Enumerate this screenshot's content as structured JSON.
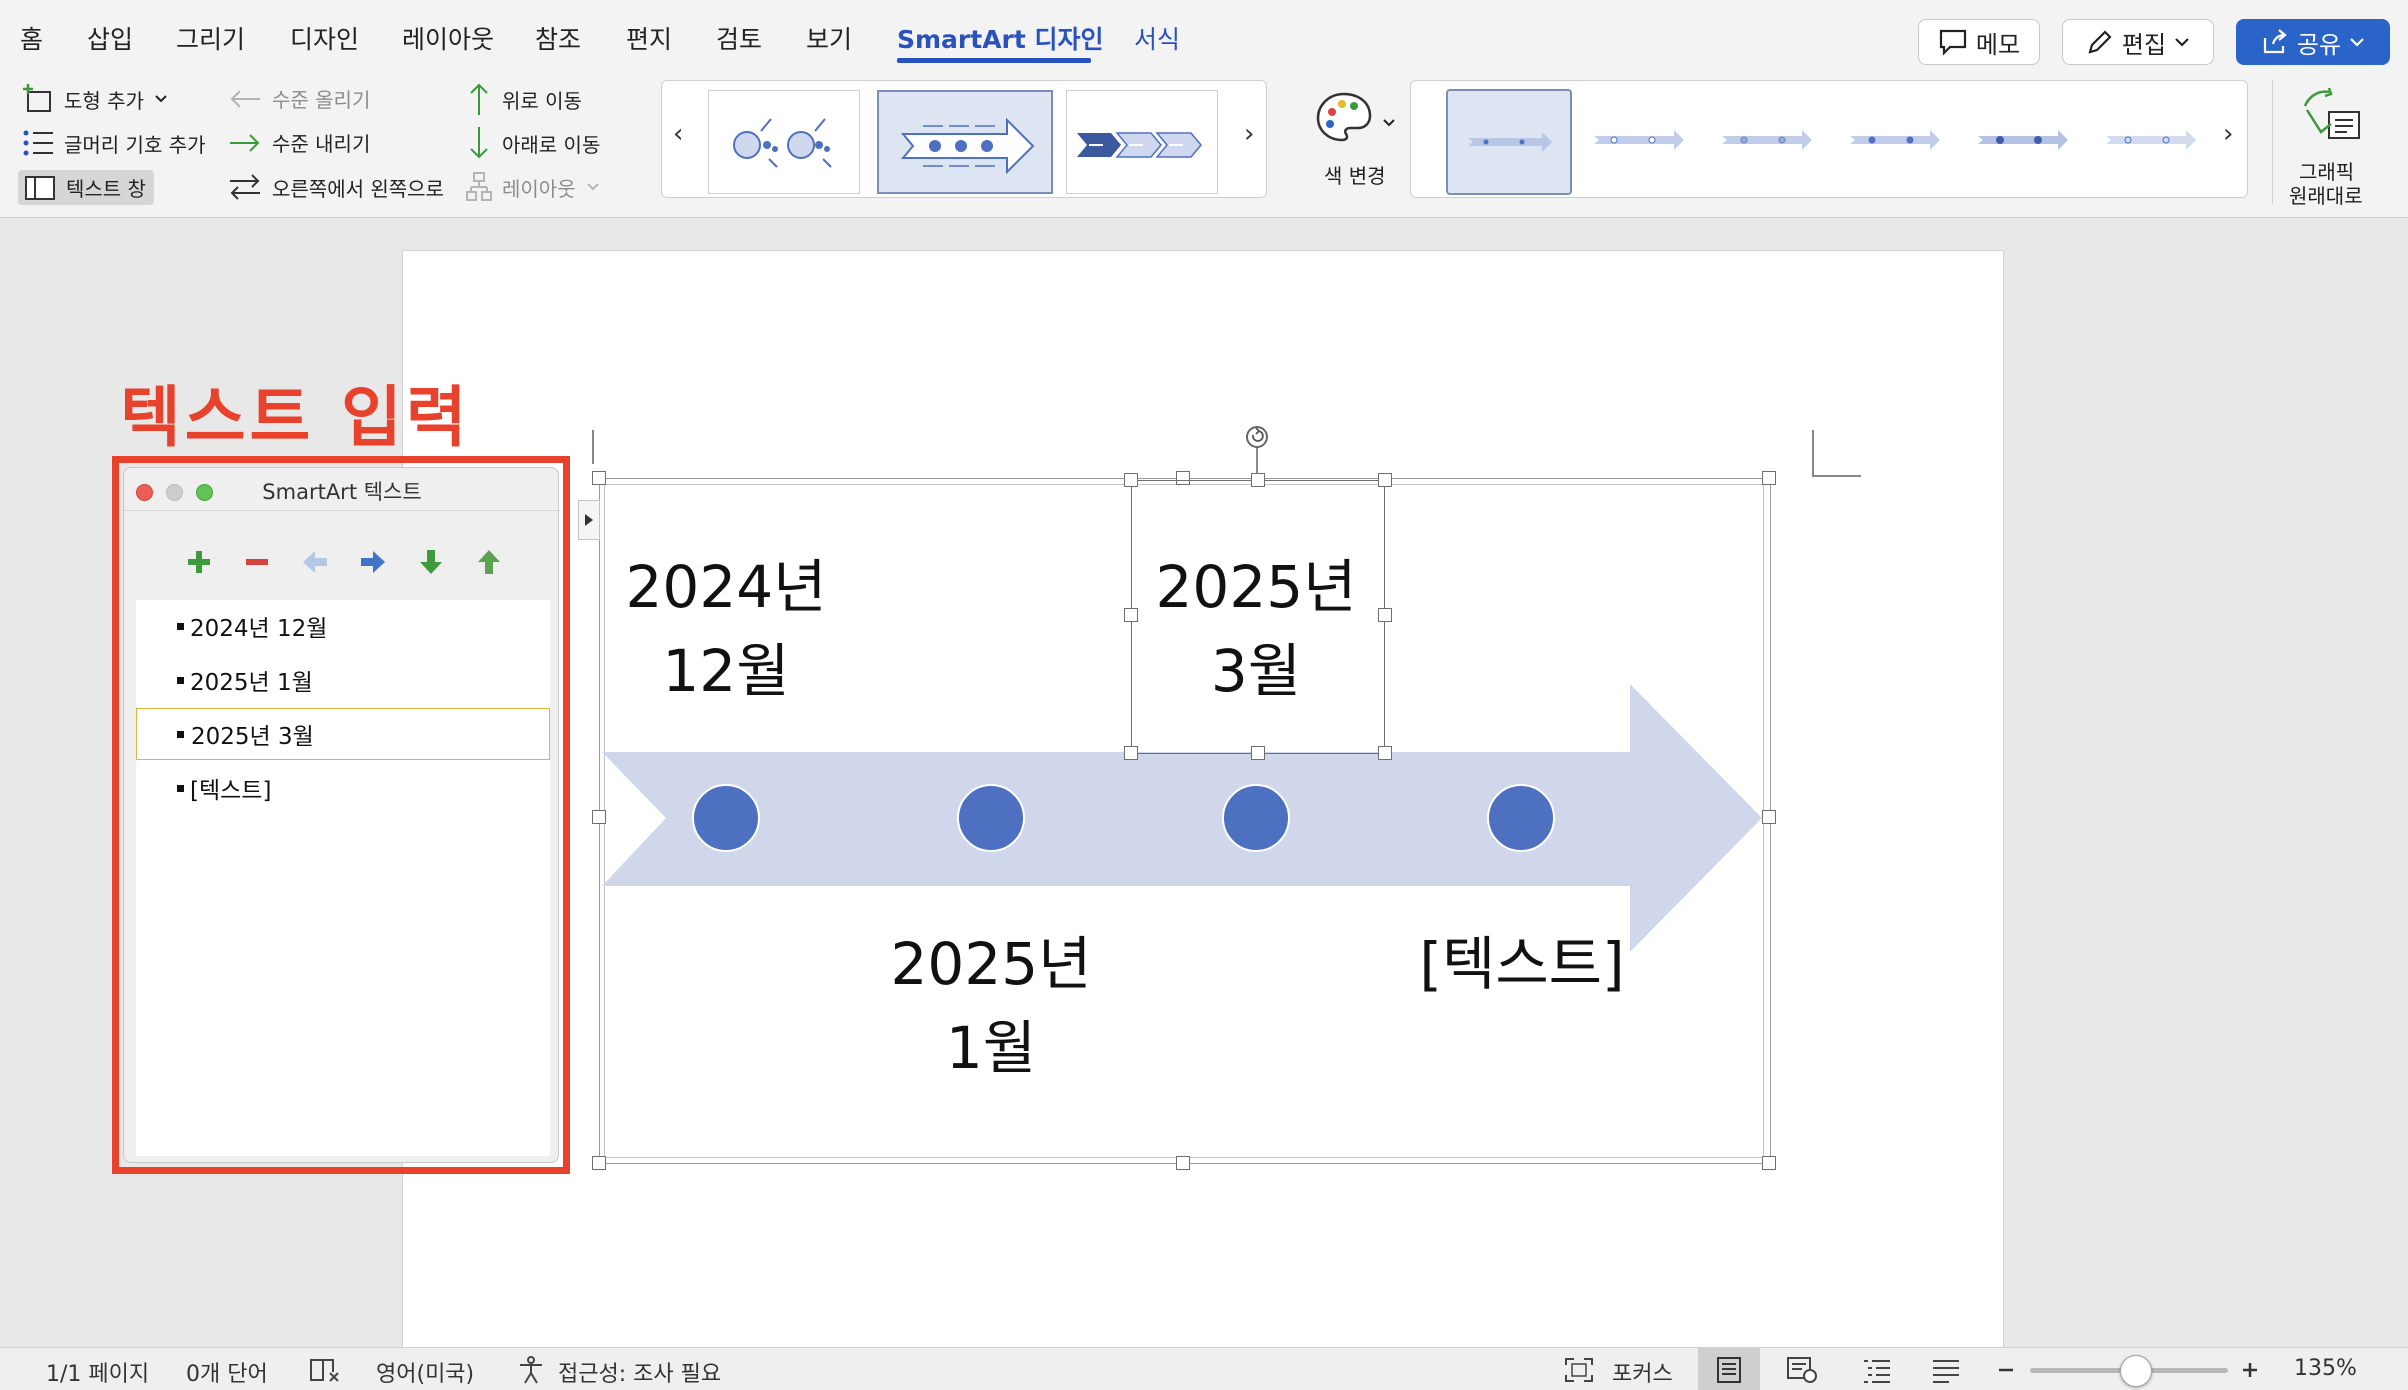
{
  "tabs": [
    {
      "label": "홈"
    },
    {
      "label": "삽입"
    },
    {
      "label": "그리기"
    },
    {
      "label": "디자인"
    },
    {
      "label": "레이아웃"
    },
    {
      "label": "참조"
    },
    {
      "label": "편지"
    },
    {
      "label": "검토"
    },
    {
      "label": "보기"
    },
    {
      "label": "SmartArt 디자인",
      "active": true
    },
    {
      "label": "서식"
    }
  ],
  "top_buttons": {
    "memo": "메모",
    "edit": "편집",
    "share": "공유"
  },
  "ribbon": {
    "add_shape": "도형 추가",
    "add_bullet": "글머리 기호 추가",
    "text_pane": "텍스트 창",
    "promote": "수준 올리기",
    "demote": "수준 내리기",
    "right_to_left": "오른쪽에서 왼쪽으로",
    "move_up": "위로 이동",
    "move_down": "아래로 이동",
    "layout": "레이아웃",
    "change_colors": "색 변경",
    "reset_graphic_line1": "그래픽",
    "reset_graphic_line2": "원래대로"
  },
  "smartart": {
    "items": [
      {
        "line1": "2024년",
        "line2": "12월"
      },
      {
        "line1": "2025년",
        "line2": "1월"
      },
      {
        "line1": "2025년",
        "line2": "3월"
      },
      {
        "text": "[텍스트]"
      }
    ],
    "arrow_color": "#d0d7ea",
    "circle_color": "#4e70c1"
  },
  "annotation": {
    "heading": "텍스트 입력",
    "color": "#e8412c"
  },
  "text_pane": {
    "title": "SmartArt 텍스트",
    "items": [
      "2024년 12월",
      "2025년 1월",
      "2025년 3월",
      "[텍스트]"
    ],
    "selected_index": 2
  },
  "status": {
    "page": "1/1 페이지",
    "words": "0개 단어",
    "language": "영어(미국)",
    "accessibility": "접근성: 조사 필요",
    "focus": "포커스",
    "zoom": "135%"
  }
}
